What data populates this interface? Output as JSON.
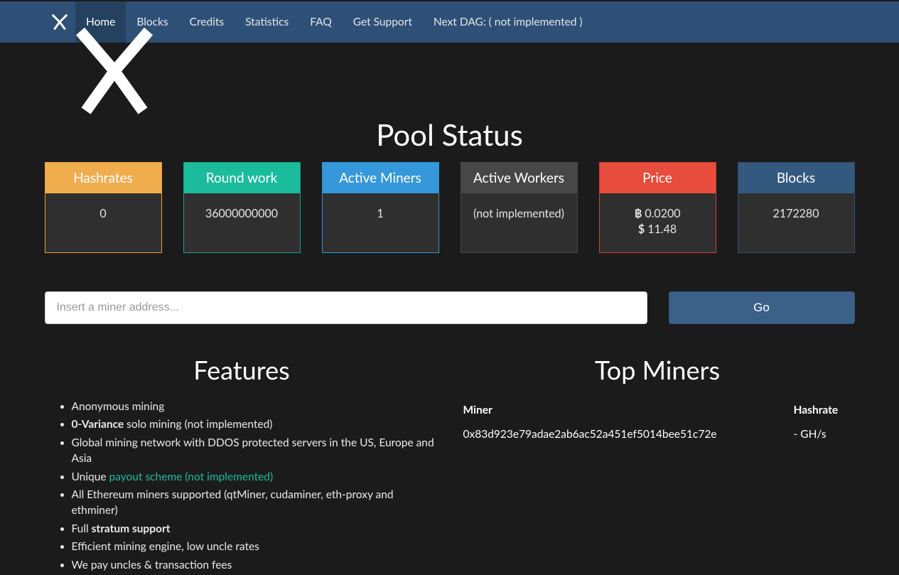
{
  "navbar": {
    "items": [
      {
        "label": "Home",
        "active": true
      },
      {
        "label": "Blocks"
      },
      {
        "label": "Credits"
      },
      {
        "label": "Statistics"
      },
      {
        "label": "FAQ"
      },
      {
        "label": "Get Support"
      },
      {
        "label": "Next DAG: ( not implemented )"
      }
    ]
  },
  "poolStatus": {
    "heading": "Pool Status",
    "cards": {
      "hashrates": {
        "title": "Hashrates",
        "value": "0"
      },
      "roundwork": {
        "title": "Round work",
        "value": "36000000000"
      },
      "activeMiners": {
        "title": "Active Miners",
        "value": "1"
      },
      "activeWorkers": {
        "title": "Active Workers",
        "value": "(not implemented)"
      },
      "price": {
        "title": "Price",
        "btc": " 0.0200",
        "usd": " 11.48"
      },
      "blocks": {
        "title": "Blocks",
        "value": "2172280"
      }
    }
  },
  "search": {
    "placeholder": "Insert a miner address...",
    "button": "Go"
  },
  "features": {
    "heading": "Features",
    "item1": "Anonymous mining",
    "item2_bold": "0-Variance",
    "item2_rest": " solo mining (not implemented)",
    "item3": "Global mining network with DDOS protected servers in the US, Europe and Asia",
    "item4_pre": "Unique ",
    "item4_link": "payout scheme (not implemented)",
    "item5": "All Ethereum miners supported (qtMiner, cudaminer, eth-proxy and ethminer)",
    "item6_pre": "Full ",
    "item6_bold": "stratum support",
    "item7": "Efficient mining engine, low uncle rates",
    "item8": "We pay uncles & transaction fees"
  },
  "topMiners": {
    "heading": "Top Miners",
    "colMiner": "Miner",
    "colHashrate": "Hashrate",
    "rows": [
      {
        "miner": "0x83d923e79adae2ab6ac52a451ef5014bee51c72e",
        "hashrate": "- GH/s"
      }
    ]
  }
}
